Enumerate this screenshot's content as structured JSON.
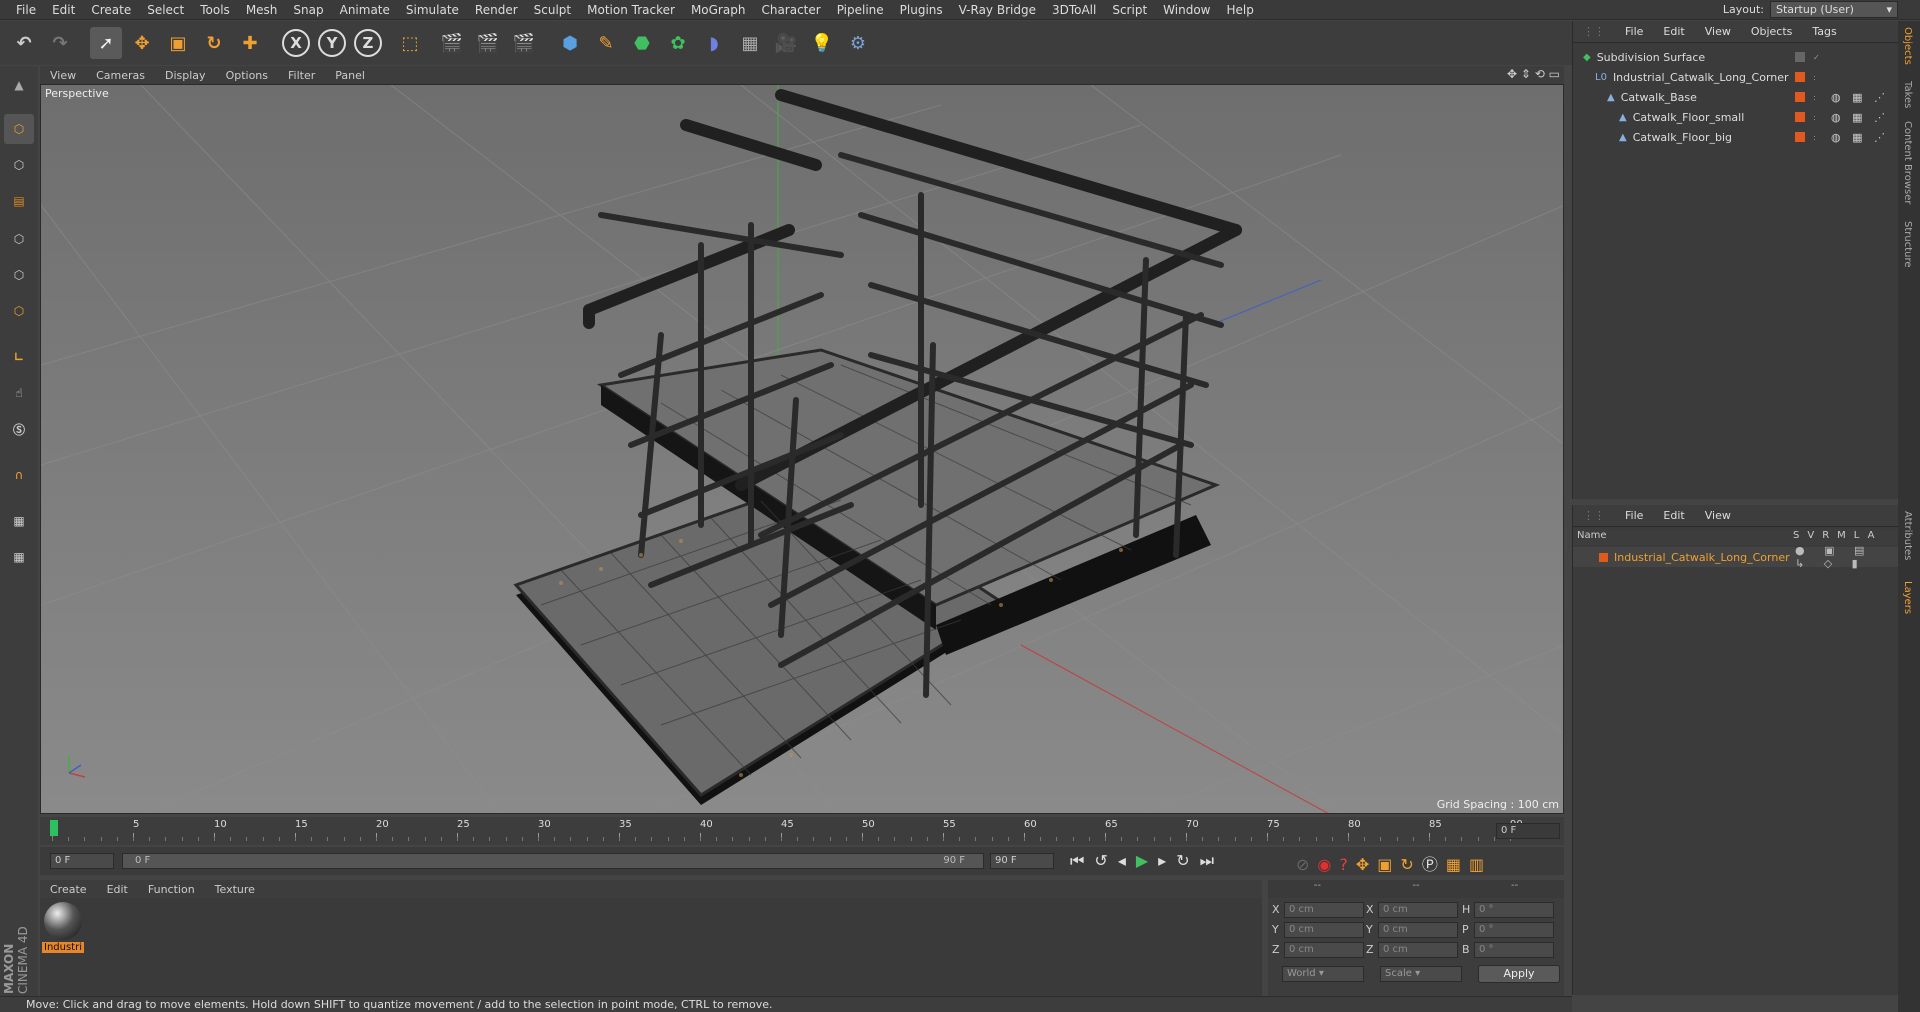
{
  "menu": [
    "File",
    "Edit",
    "Create",
    "Select",
    "Tools",
    "Mesh",
    "Snap",
    "Animate",
    "Simulate",
    "Render",
    "Sculpt",
    "Motion Tracker",
    "MoGraph",
    "Character",
    "Pipeline",
    "Plugins",
    "V-Ray Bridge",
    "3DToAll",
    "Script",
    "Window",
    "Help"
  ],
  "layout": {
    "label": "Layout:",
    "value": "Startup (User)"
  },
  "viewport": {
    "menu": [
      "View",
      "Cameras",
      "Display",
      "Options",
      "Filter",
      "Panel"
    ],
    "camera": "Perspective",
    "grid_spacing": "Grid Spacing : 100 cm"
  },
  "timeline": {
    "ticks": [
      "0",
      "5",
      "10",
      "15",
      "20",
      "25",
      "30",
      "35",
      "40",
      "45",
      "50",
      "55",
      "60",
      "65",
      "70",
      "75",
      "80",
      "85",
      "90"
    ],
    "current_frame": "0 F",
    "start_field": "0 F",
    "range_start": "0 F",
    "range_end": "90 F",
    "end_field": "90 F"
  },
  "material": {
    "menu": [
      "Create",
      "Edit",
      "Function",
      "Texture"
    ],
    "item_label": "Industri"
  },
  "coords": {
    "headers": [
      "--",
      "--",
      "--"
    ],
    "rows": [
      {
        "a": "X",
        "av": "0 cm",
        "b": "X",
        "bv": "0 cm",
        "c": "H",
        "cv": "0 °"
      },
      {
        "a": "Y",
        "av": "0 cm",
        "b": "Y",
        "bv": "0 cm",
        "c": "P",
        "cv": "0 °"
      },
      {
        "a": "Z",
        "av": "0 cm",
        "b": "Z",
        "bv": "0 cm",
        "c": "B",
        "cv": "0 °"
      }
    ],
    "world": "World",
    "scale": "Scale",
    "apply": "Apply"
  },
  "status": "Move: Click and drag to move elements. Hold down SHIFT to quantize movement / add to the selection in point mode, CTRL to remove.",
  "objects": {
    "menu": [
      "File",
      "Edit",
      "View",
      "Objects",
      "Tags"
    ],
    "items": [
      {
        "name": "Subdivision Surface",
        "indent": 0
      },
      {
        "name": "Industrial_Catwalk_Long_Corner",
        "indent": 1
      },
      {
        "name": "Catwalk_Base",
        "indent": 2
      },
      {
        "name": "Catwalk_Floor_small",
        "indent": 3
      },
      {
        "name": "Catwalk_Floor_big",
        "indent": 3
      }
    ]
  },
  "layers": {
    "menu": [
      "File",
      "Edit",
      "View"
    ],
    "col_name": "Name",
    "cols": [
      "S",
      "V",
      "R",
      "M",
      "L",
      "A"
    ],
    "item": "Industrial_Catwalk_Long_Corner"
  },
  "side_tabs": [
    "Objects",
    "Takes",
    "Content Browser",
    "Structure",
    "Attributes",
    "Layers"
  ],
  "brand": [
    "MAXON",
    "CINEMA 4D"
  ],
  "colors": {
    "accent": "#e8862a",
    "layer_orange": "#e08a1a",
    "selected_text": "#f0a030"
  }
}
